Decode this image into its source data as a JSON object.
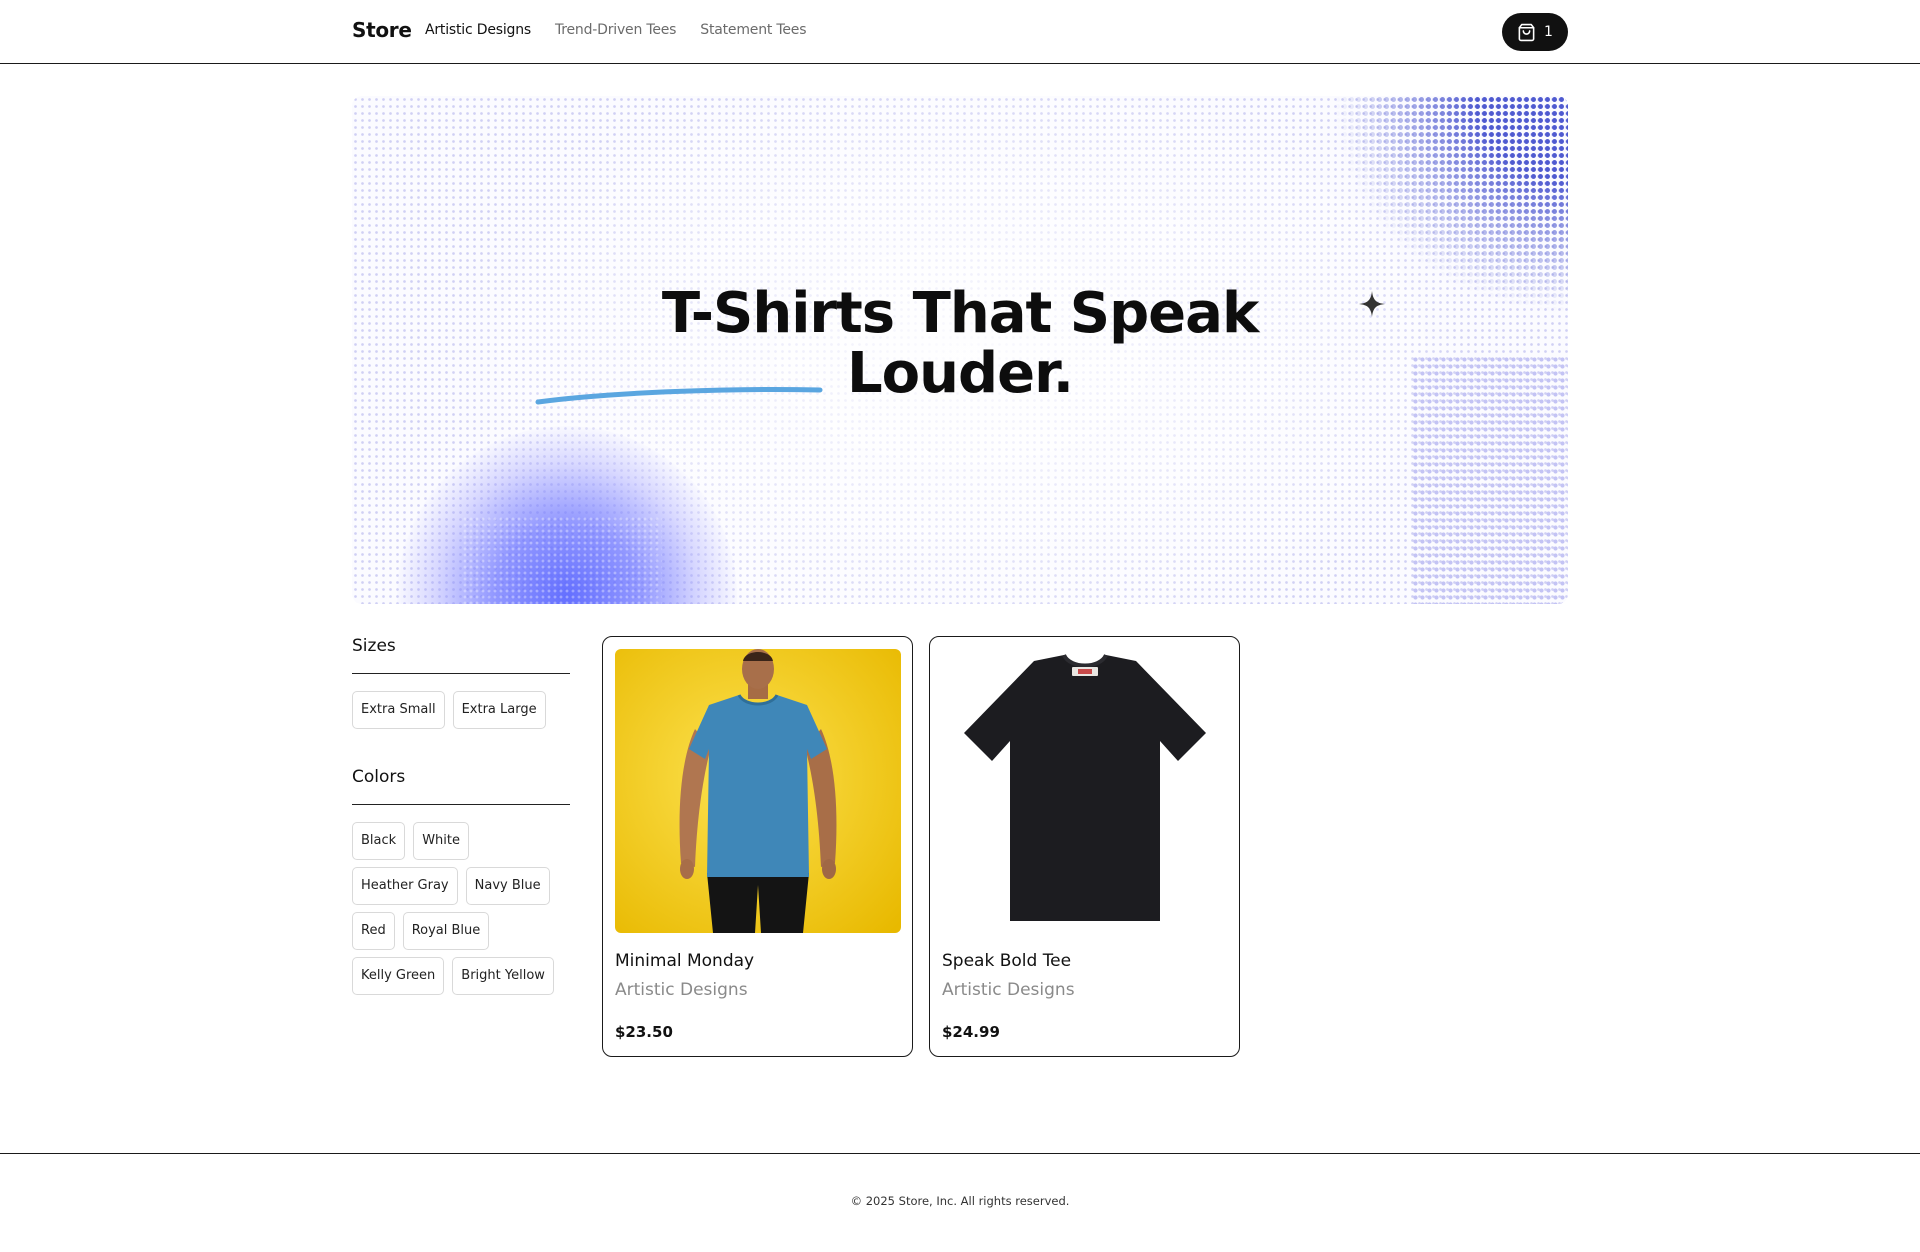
{
  "header": {
    "brand": "Store",
    "nav": [
      {
        "label": "Artistic Designs",
        "active": true
      },
      {
        "label": "Trend-Driven Tees",
        "active": false
      },
      {
        "label": "Statement Tees",
        "active": false
      }
    ],
    "cart_count": "1",
    "cart_icon": "shopping-bag-icon"
  },
  "hero": {
    "title_line1": "T-Shirts That Speak",
    "title_line2": "Louder.",
    "accent_color": "#5b6cff",
    "stroke_color": "#5aa6e0"
  },
  "filters": {
    "sizes_heading": "Sizes",
    "sizes": [
      "Extra Small",
      "Extra Large"
    ],
    "colors_heading": "Colors",
    "colors": [
      "Black",
      "White",
      "Heather Gray",
      "Navy Blue",
      "Red",
      "Royal Blue",
      "Kelly Green",
      "Bright Yellow"
    ]
  },
  "products": [
    {
      "name": "Minimal Monday",
      "category": "Artistic Designs",
      "price": "$23.50",
      "image": "man-in-blue-tshirt-on-yellow"
    },
    {
      "name": "Speak Bold Tee",
      "category": "Artistic Designs",
      "price": "$24.99",
      "image": "black-tshirt-flatlay"
    }
  ],
  "footer": {
    "copyright": "© 2025 Store, Inc. All rights reserved."
  }
}
